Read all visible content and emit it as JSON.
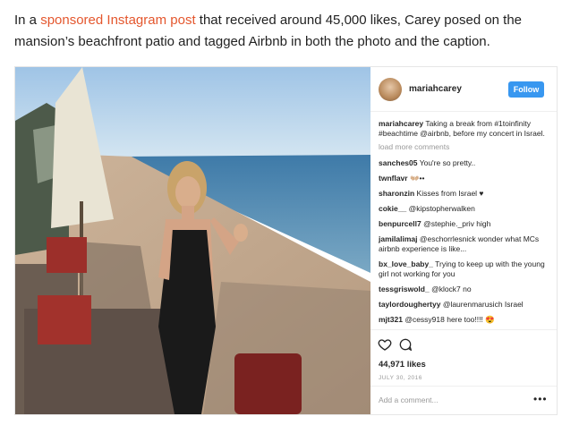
{
  "article": {
    "text_before": "In a ",
    "link": "sponsored Instagram post",
    "text_after": " that received around 45,000 likes, Carey posed on the mansion’s beachfront patio and tagged Airbnb in both the photo and the caption."
  },
  "instagram": {
    "username": "mariahcarey",
    "follow_label": "Follow",
    "caption": {
      "user": "mariahcarey",
      "text": "Taking a break from #1toinfinity #beachtime @airbnb, before my concert in Israel."
    },
    "load_more": "load more comments",
    "comments": [
      {
        "user": "sanches05",
        "text": "You're so pretty.."
      },
      {
        "user": "twnflavr",
        "text": "👐🏼••"
      },
      {
        "user": "sharonzin",
        "text": "Kisses from Israel ♥"
      },
      {
        "user": "cokie__",
        "text": "@kipstopherwalken"
      },
      {
        "user": "benpurcell7",
        "text": "@stephie._priv high"
      },
      {
        "user": "jamilalimaj",
        "text": "@eschorrlesnick wonder what MCs airbnb experience is like..."
      },
      {
        "user": "bx_love_baby_",
        "text": "Trying to keep up with the young girl not working for you"
      },
      {
        "user": "tessgriswold_",
        "text": "@klock7 no"
      },
      {
        "user": "taylordoughertyy",
        "text": "@laurenmarusich Israel"
      },
      {
        "user": "mjt321",
        "text": "@cessy918 here too!!!! 😍"
      }
    ],
    "likes": "44,971 likes",
    "date": "JULY 30, 2016",
    "add_comment_placeholder": "Add a comment...",
    "more_label": "•••"
  }
}
